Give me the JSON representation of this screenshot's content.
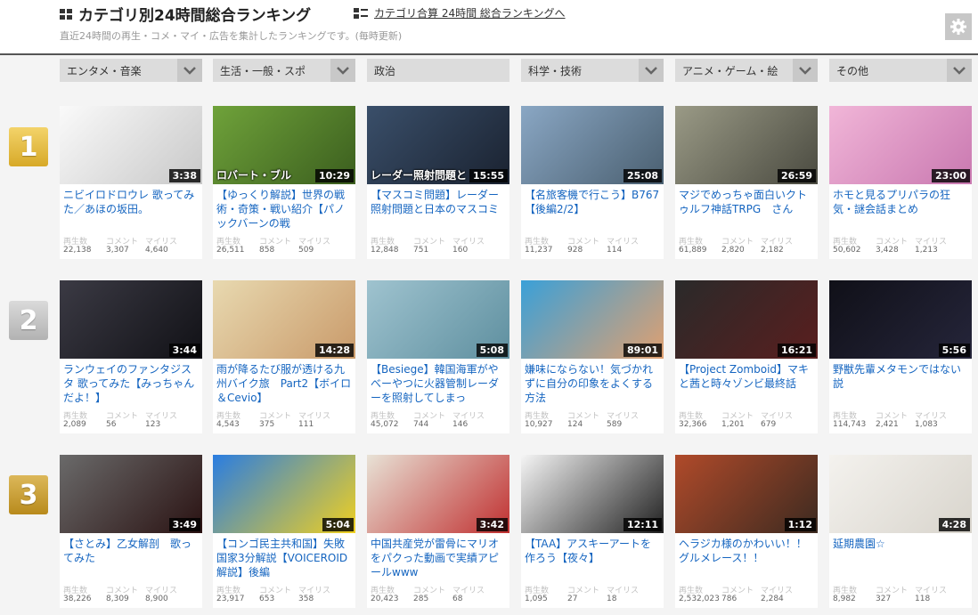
{
  "header": {
    "title": "カテゴリ別24時間総合ランキング",
    "link": "カテゴリ合算 24時間 総合ランキングへ",
    "subtitle": "直近24時間の再生・コメ・マイ・広告を集計したランキングです。(毎時更新)"
  },
  "categories": [
    {
      "label": "エンタメ・音楽",
      "has_dropdown": true
    },
    {
      "label": "生活・一般・スポ",
      "has_dropdown": true
    },
    {
      "label": "政治",
      "has_dropdown": false
    },
    {
      "label": "科学・技術",
      "has_dropdown": true
    },
    {
      "label": "アニメ・ゲーム・絵",
      "has_dropdown": true
    },
    {
      "label": "その他",
      "has_dropdown": true
    }
  ],
  "ranks": [
    "1",
    "2",
    "3"
  ],
  "stat_labels": {
    "views": "再生数",
    "comments": "コメント",
    "mylist": "マイリス"
  },
  "rows": [
    [
      {
        "title": "ニビイロドロウレ 歌ってみた／あほの坂田。",
        "duration": "3:38",
        "views": "22,138",
        "comments": "3,307",
        "mylist": "4,640",
        "thumb": [
          "#fafafa",
          "#c8c8c8"
        ]
      },
      {
        "title": "【ゆっくり解説】世界の戦術・奇策・戦い紹介【パノックバーンの戦",
        "duration": "10:29",
        "views": "26,511",
        "comments": "858",
        "mylist": "509",
        "thumb": [
          "#6fa23a",
          "#3b5e1e"
        ],
        "caption": "ロバート・ブル"
      },
      {
        "title": "【マスコミ問題】レーダー照射問題と日本のマスコミ",
        "duration": "15:55",
        "views": "12,848",
        "comments": "751",
        "mylist": "160",
        "thumb": [
          "#3a4f6a",
          "#1a2230"
        ],
        "caption": "レーダー照射問題と"
      },
      {
        "title": "【名旅客機で行こう】B767【後編2/2】",
        "duration": "25:08",
        "views": "11,237",
        "comments": "928",
        "mylist": "114",
        "thumb": [
          "#8aa7c4",
          "#4a5f70"
        ]
      },
      {
        "title": "マジでめっちゃ面白いクトゥルフ神話TRPG　さん",
        "duration": "26:59",
        "views": "61,889",
        "comments": "2,820",
        "mylist": "2,182",
        "thumb": [
          "#9a9a86",
          "#4a4a40"
        ]
      },
      {
        "title": "ホモと見るプリパラの狂気・謎会話まとめ",
        "duration": "23:00",
        "views": "50,602",
        "comments": "3,428",
        "mylist": "1,213",
        "thumb": [
          "#f1b6d8",
          "#c978b0"
        ]
      }
    ],
    [
      {
        "title": "ランウェイのファンタジスタ 歌ってみた【みっちゃんだよ！】",
        "duration": "3:44",
        "views": "2,089",
        "comments": "56",
        "mylist": "123",
        "thumb": [
          "#3b3a44",
          "#111116"
        ]
      },
      {
        "title": "雨が降るたび服が透ける九州バイク旅　Part2【ボイロ＆Cevio】",
        "duration": "14:28",
        "views": "4,543",
        "comments": "375",
        "mylist": "111",
        "thumb": [
          "#e8d9b0",
          "#c99a6a"
        ]
      },
      {
        "title": "【Besiege】韓国海軍がやべーやつに火器管制レーダーを照射してしまっ",
        "duration": "5:08",
        "views": "45,072",
        "comments": "744",
        "mylist": "146",
        "thumb": [
          "#9fc3cf",
          "#5e8f9f"
        ]
      },
      {
        "title": "嫌味にならない！気づかれずに自分の印象をよくする方法",
        "duration": "89:01",
        "views": "10,927",
        "comments": "124",
        "mylist": "589",
        "thumb": [
          "#3aa0d8",
          "#e0a070"
        ]
      },
      {
        "title": "【Project Zomboid】マキと茜と時々ゾンビ最終話",
        "duration": "16:21",
        "views": "32,366",
        "comments": "1,201",
        "mylist": "679",
        "thumb": [
          "#2a2a2a",
          "#5a1e1e"
        ]
      },
      {
        "title": "野獣先輩メタモンではない説",
        "duration": "5:56",
        "views": "114,743",
        "comments": "2,421",
        "mylist": "1,083",
        "thumb": [
          "#101018",
          "#25253a"
        ]
      }
    ],
    [
      {
        "title": "【さとみ】乙女解剖　歌ってみた",
        "duration": "3:49",
        "views": "38,226",
        "comments": "8,309",
        "mylist": "8,900",
        "thumb": [
          "#6a6a6a",
          "#2a1212"
        ]
      },
      {
        "title": "【コンゴ民主共和国】失敗国家3分解説【VOICEROID解説】後編",
        "duration": "5:04",
        "views": "23,917",
        "comments": "653",
        "mylist": "358",
        "thumb": [
          "#2a7de1",
          "#f0d020"
        ]
      },
      {
        "title": "中国共産党が雷骨にマリオをパクった動画で実績アピールwww",
        "duration": "3:42",
        "views": "20,423",
        "comments": "285",
        "mylist": "68",
        "thumb": [
          "#e8e2d6",
          "#c03030"
        ]
      },
      {
        "title": "【TAA】アスキーアートを作ろう【夜々】",
        "duration": "12:11",
        "views": "1,095",
        "comments": "27",
        "mylist": "18",
        "thumb": [
          "#f5f5f5",
          "#202020"
        ]
      },
      {
        "title": "ヘラジカ様のかわいい！！グルメレース！！",
        "duration": "1:12",
        "views": "2,532,023",
        "comments": "786",
        "mylist": "2,284",
        "thumb": [
          "#b04a2a",
          "#3c2a20"
        ]
      },
      {
        "title": "延期農園☆",
        "duration": "4:28",
        "views": "8,982",
        "comments": "327",
        "mylist": "118",
        "thumb": [
          "#f4f2ee",
          "#d8d4cc"
        ]
      }
    ]
  ]
}
